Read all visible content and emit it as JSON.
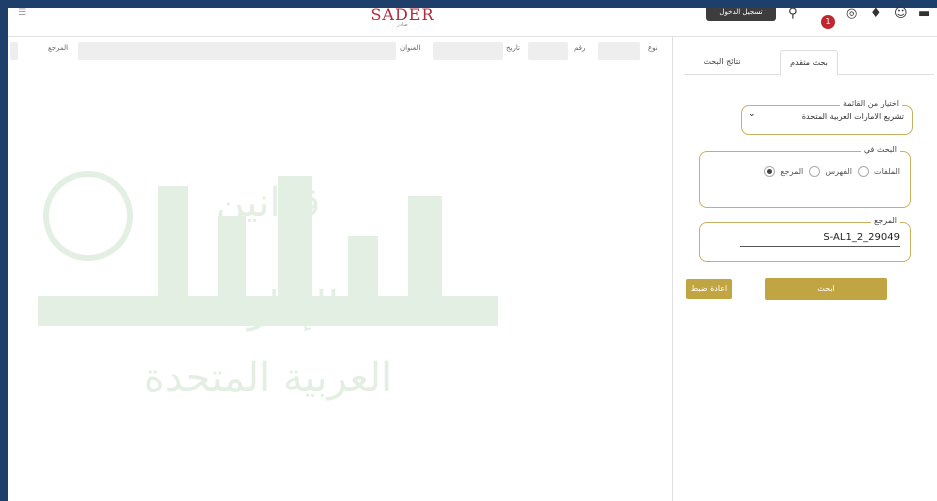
{
  "header": {
    "logo_text": "SADER",
    "logo_sub": "صادر",
    "account_button": "تسجيل الدخول",
    "notification_count": "1"
  },
  "results": {
    "columns": [
      "نوع",
      "رقم",
      "تاريخ",
      "العنوان",
      "المرجع"
    ],
    "watermark_line1": "قوانين",
    "watermark_line2": "الإمارات",
    "watermark_line3": "العربية المتحدة"
  },
  "panel": {
    "tab_advanced": "بحث متقدم",
    "tab_results": "نتائج البحث",
    "list_legend": "اختيار من القائمة",
    "list_selected": "تشريع الامارات العربية المتحدة",
    "search_in_legend": "البحث في",
    "radio_files": "الملفات",
    "radio_index": "الفهرس",
    "radio_reference": "المرجع",
    "reference_legend": "المرجع",
    "reference_value": "S-AL1_2_29049",
    "search_button": "ابحث",
    "reset_button": "اعادة ضبط"
  },
  "colors": {
    "gold": "#c2a543",
    "frame": "#1f3f6b",
    "brand": "#b12a3d"
  }
}
